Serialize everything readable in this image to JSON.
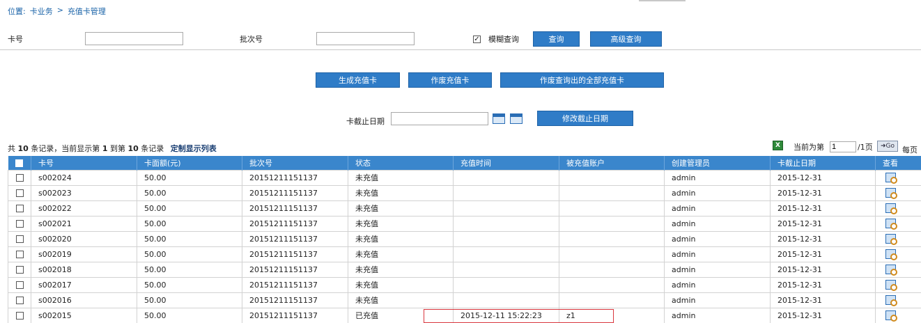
{
  "breadcrumb": {
    "prefix": "位置:",
    "level1": "卡业务",
    "sep": ">",
    "level2": "充值卡管理"
  },
  "search": {
    "card_no_label": "卡号",
    "card_no_value": "",
    "batch_label": "批次号",
    "batch_value": "",
    "fuzzy_checked": "✓",
    "fuzzy_label": "模糊查询",
    "query_button": "查询",
    "advanced_button": "高级查询"
  },
  "actions": {
    "generate": "生成充值卡",
    "void": "作废充值卡",
    "void_all": "作废查询出的全部充值卡"
  },
  "expiry": {
    "label": "卡截止日期",
    "value": "",
    "button": "修改截止日期"
  },
  "summary": {
    "p1": "共",
    "total": "10",
    "p2": "条记录，当前显示第",
    "from": "1",
    "p3": "到第",
    "to": "10",
    "p4": "条记录",
    "custom_columns": "定制显示列表"
  },
  "pager": {
    "prefix": "当前为第",
    "page": "1",
    "suffix": "/1页",
    "go": "Go",
    "per_page": "每页"
  },
  "table": {
    "headers": [
      "卡号",
      "卡面额(元)",
      "批次号",
      "状态",
      "充值时间",
      "被充值账户",
      "创建管理员",
      "卡截止日期",
      "查看"
    ],
    "rows": [
      [
        "s002024",
        "50.00",
        "20151211151137",
        "未充值",
        "",
        "",
        "admin",
        "2015-12-31"
      ],
      [
        "s002023",
        "50.00",
        "20151211151137",
        "未充值",
        "",
        "",
        "admin",
        "2015-12-31"
      ],
      [
        "s002022",
        "50.00",
        "20151211151137",
        "未充值",
        "",
        "",
        "admin",
        "2015-12-31"
      ],
      [
        "s002021",
        "50.00",
        "20151211151137",
        "未充值",
        "",
        "",
        "admin",
        "2015-12-31"
      ],
      [
        "s002020",
        "50.00",
        "20151211151137",
        "未充值",
        "",
        "",
        "admin",
        "2015-12-31"
      ],
      [
        "s002019",
        "50.00",
        "20151211151137",
        "未充值",
        "",
        "",
        "admin",
        "2015-12-31"
      ],
      [
        "s002018",
        "50.00",
        "20151211151137",
        "未充值",
        "",
        "",
        "admin",
        "2015-12-31"
      ],
      [
        "s002017",
        "50.00",
        "20151211151137",
        "未充值",
        "",
        "",
        "admin",
        "2015-12-31"
      ],
      [
        "s002016",
        "50.00",
        "20151211151137",
        "未充值",
        "",
        "",
        "admin",
        "2015-12-31"
      ],
      [
        "s002015",
        "50.00",
        "20151211151137",
        "已充值",
        "2015-12-11 15:22:23",
        "z1",
        "admin",
        "2015-12-31"
      ]
    ]
  },
  "colors": {
    "accent": "#2f7cc7",
    "header": "#3a86cc",
    "link": "#1a63a8",
    "highlight": "#d9363e"
  }
}
